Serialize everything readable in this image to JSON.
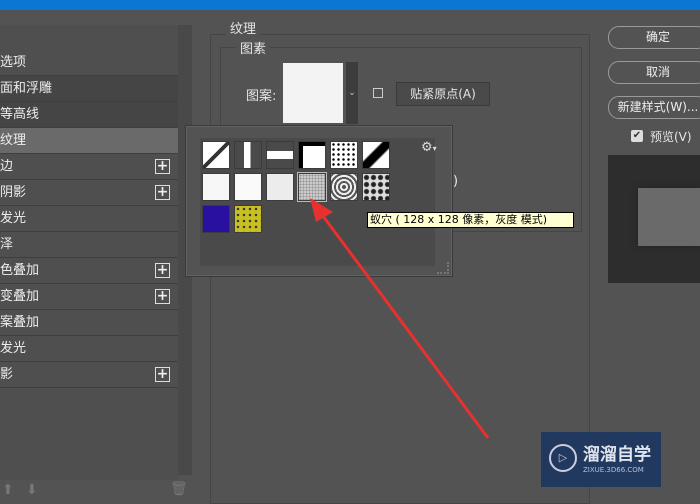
{
  "sidebar": {
    "items": [
      {
        "label": "选项",
        "plus": false
      },
      {
        "label": "面和浮雕",
        "plus": false
      },
      {
        "label": "等高线",
        "plus": false
      },
      {
        "label": "纹理",
        "plus": false
      },
      {
        "label": "边",
        "plus": true
      },
      {
        "label": "阴影",
        "plus": true
      },
      {
        "label": "发光",
        "plus": false
      },
      {
        "label": "泽",
        "plus": false
      },
      {
        "label": "色叠加",
        "plus": true
      },
      {
        "label": "变叠加",
        "plus": true
      },
      {
        "label": "案叠加",
        "plus": false
      },
      {
        "label": "发光",
        "plus": false
      },
      {
        "label": "影",
        "plus": true
      }
    ],
    "plus_symbol": "+"
  },
  "main": {
    "group_title": "纹理",
    "subgroup_title": "图素",
    "pattern_label": "图案:",
    "snap_button": "贴紧原点(A)",
    "partial_text": ")"
  },
  "popup": {
    "tooltip": "蚁穴 ( 128 x 128 像素，灰度 模式)",
    "gear_icon": "gear-icon"
  },
  "right": {
    "ok": "确定",
    "cancel": "取消",
    "new_style": "新建样式(W)...",
    "preview_label": "预览(V)",
    "preview_checked": true
  },
  "watermark": {
    "title": "溜溜自学",
    "url": "ZIXUE.3D66.COM"
  },
  "colors": {
    "accent": "#0a78d2",
    "arrow": "#e8302f",
    "tooltip": "#ffffd2"
  }
}
